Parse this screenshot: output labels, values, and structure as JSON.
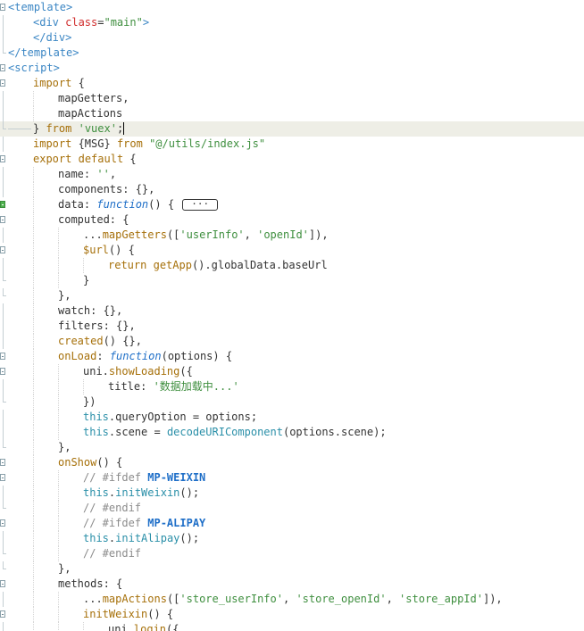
{
  "editor": {
    "lines": [
      {
        "fold": "open",
        "indent": 0,
        "tokens": [
          [
            "tag",
            "<template>"
          ]
        ]
      },
      {
        "fold": "line",
        "indent": 1,
        "tokens": [
          [
            "tag",
            "<div "
          ],
          [
            "attr",
            "class"
          ],
          [
            "pl",
            "="
          ],
          [
            "str",
            "\"main\""
          ],
          [
            "tag",
            ">"
          ]
        ]
      },
      {
        "fold": "line",
        "indent": 1,
        "tokens": [
          [
            "tag",
            "</div>"
          ]
        ]
      },
      {
        "fold": "end",
        "indent": 0,
        "tokens": [
          [
            "tag",
            "</template>"
          ]
        ]
      },
      {
        "fold": "open",
        "indent": 0,
        "tokens": [
          [
            "tag",
            "<script>"
          ]
        ]
      },
      {
        "fold": "open",
        "indent": 1,
        "tokens": [
          [
            "kw",
            "import"
          ],
          [
            "pl",
            " {"
          ]
        ]
      },
      {
        "fold": "line",
        "indent": 2,
        "tokens": [
          [
            "pl",
            "mapGetters,"
          ]
        ]
      },
      {
        "fold": "line",
        "indent": 2,
        "tokens": [
          [
            "pl",
            "mapActions"
          ]
        ]
      },
      {
        "fold": "end",
        "indent": 1,
        "current": true,
        "caret": true,
        "tokens": [
          [
            "pl",
            "} "
          ],
          [
            "kw",
            "from"
          ],
          [
            "pl",
            " "
          ],
          [
            "str",
            "'vuex'"
          ],
          [
            "pl",
            ";"
          ]
        ]
      },
      {
        "fold": "line",
        "indent": 1,
        "tokens": [
          [
            "kw",
            "import"
          ],
          [
            "pl",
            " {MSG} "
          ],
          [
            "kw",
            "from"
          ],
          [
            "pl",
            " "
          ],
          [
            "str",
            "\"@/utils/index.js\""
          ]
        ]
      },
      {
        "fold": "open",
        "indent": 1,
        "tokens": [
          [
            "kw",
            "export"
          ],
          [
            "pl",
            " "
          ],
          [
            "kw",
            "default"
          ],
          [
            "pl",
            " {"
          ]
        ]
      },
      {
        "fold": "line",
        "indent": 2,
        "tokens": [
          [
            "pl",
            "name: "
          ],
          [
            "str",
            "''"
          ],
          [
            "pl",
            ","
          ]
        ]
      },
      {
        "fold": "line",
        "indent": 2,
        "tokens": [
          [
            "pl",
            "components: {},"
          ]
        ]
      },
      {
        "fold": "collapsed",
        "indent": 2,
        "placeholder": "···",
        "tokens": [
          [
            "pl",
            "data: "
          ],
          [
            "kwi",
            "function"
          ],
          [
            "pl",
            "() { "
          ]
        ]
      },
      {
        "fold": "open",
        "indent": 2,
        "tokens": [
          [
            "pl",
            "computed: {"
          ]
        ]
      },
      {
        "fold": "line",
        "indent": 3,
        "tokens": [
          [
            "pl",
            "..."
          ],
          [
            "fn",
            "mapGetters"
          ],
          [
            "pl",
            "(["
          ],
          [
            "str",
            "'userInfo'"
          ],
          [
            "pl",
            ", "
          ],
          [
            "str",
            "'openId'"
          ],
          [
            "pl",
            "]),"
          ]
        ]
      },
      {
        "fold": "open",
        "indent": 3,
        "tokens": [
          [
            "fn",
            "$url"
          ],
          [
            "pl",
            "() {"
          ]
        ]
      },
      {
        "fold": "line",
        "indent": 4,
        "tokens": [
          [
            "kw",
            "return"
          ],
          [
            "pl",
            " "
          ],
          [
            "fn",
            "getApp"
          ],
          [
            "pl",
            "().globalData.baseUrl"
          ]
        ]
      },
      {
        "fold": "end",
        "indent": 3,
        "tokens": [
          [
            "pl",
            "}"
          ]
        ]
      },
      {
        "fold": "end",
        "indent": 2,
        "tokens": [
          [
            "pl",
            "},"
          ]
        ]
      },
      {
        "fold": "line",
        "indent": 2,
        "tokens": [
          [
            "pl",
            "watch: {},"
          ]
        ]
      },
      {
        "fold": "line",
        "indent": 2,
        "tokens": [
          [
            "pl",
            "filters: {},"
          ]
        ]
      },
      {
        "fold": "line",
        "indent": 2,
        "tokens": [
          [
            "fn",
            "created"
          ],
          [
            "pl",
            "() {},"
          ]
        ]
      },
      {
        "fold": "open",
        "indent": 2,
        "tokens": [
          [
            "fn",
            "onLoad"
          ],
          [
            "pl",
            ": "
          ],
          [
            "kwi",
            "function"
          ],
          [
            "pl",
            "(options) {"
          ]
        ]
      },
      {
        "fold": "open",
        "indent": 3,
        "tokens": [
          [
            "pl",
            "uni."
          ],
          [
            "fn",
            "showLoading"
          ],
          [
            "pl",
            "({"
          ]
        ]
      },
      {
        "fold": "line",
        "indent": 4,
        "tokens": [
          [
            "pl",
            "title: "
          ],
          [
            "str",
            "'数据加载中...'"
          ]
        ]
      },
      {
        "fold": "end",
        "indent": 3,
        "tokens": [
          [
            "pl",
            "})"
          ]
        ]
      },
      {
        "fold": "line",
        "indent": 3,
        "tokens": [
          [
            "call",
            "this"
          ],
          [
            "pl",
            ".queryOption = options;"
          ]
        ]
      },
      {
        "fold": "line",
        "indent": 3,
        "tokens": [
          [
            "call",
            "this"
          ],
          [
            "pl",
            ".scene = "
          ],
          [
            "call",
            "decodeURIComponent"
          ],
          [
            "pl",
            "(options.scene);"
          ]
        ]
      },
      {
        "fold": "end",
        "indent": 2,
        "tokens": [
          [
            "pl",
            "},"
          ]
        ]
      },
      {
        "fold": "open",
        "indent": 2,
        "tokens": [
          [
            "fn",
            "onShow"
          ],
          [
            "pl",
            "() {"
          ]
        ]
      },
      {
        "fold": "open",
        "indent": 3,
        "tokens": [
          [
            "cm",
            "// #ifdef "
          ],
          [
            "dir",
            "MP-WEIXIN"
          ]
        ]
      },
      {
        "fold": "line",
        "indent": 3,
        "tokens": [
          [
            "call",
            "this"
          ],
          [
            "pl",
            "."
          ],
          [
            "call",
            "initWeixin"
          ],
          [
            "pl",
            "();"
          ]
        ]
      },
      {
        "fold": "end",
        "indent": 3,
        "tokens": [
          [
            "cm",
            "// #endif"
          ]
        ]
      },
      {
        "fold": "open",
        "indent": 3,
        "tokens": [
          [
            "cm",
            "// #ifdef "
          ],
          [
            "dir",
            "MP-ALIPAY"
          ]
        ]
      },
      {
        "fold": "line",
        "indent": 3,
        "tokens": [
          [
            "call",
            "this"
          ],
          [
            "pl",
            "."
          ],
          [
            "call",
            "initAlipay"
          ],
          [
            "pl",
            "();"
          ]
        ]
      },
      {
        "fold": "end",
        "indent": 3,
        "tokens": [
          [
            "cm",
            "// #endif"
          ]
        ]
      },
      {
        "fold": "end",
        "indent": 2,
        "tokens": [
          [
            "pl",
            "},"
          ]
        ]
      },
      {
        "fold": "open",
        "indent": 2,
        "tokens": [
          [
            "pl",
            "methods: {"
          ]
        ]
      },
      {
        "fold": "line",
        "indent": 3,
        "tokens": [
          [
            "pl",
            "..."
          ],
          [
            "fn",
            "mapActions"
          ],
          [
            "pl",
            "(["
          ],
          [
            "str",
            "'store_userInfo'"
          ],
          [
            "pl",
            ", "
          ],
          [
            "str",
            "'store_openId'"
          ],
          [
            "pl",
            ", "
          ],
          [
            "str",
            "'store_appId'"
          ],
          [
            "pl",
            "]),"
          ]
        ]
      },
      {
        "fold": "open",
        "indent": 3,
        "tokens": [
          [
            "fn",
            "initWeixin"
          ],
          [
            "pl",
            "() {"
          ]
        ]
      },
      {
        "fold": "line",
        "indent": 4,
        "tokens": [
          [
            "pl",
            "uni."
          ],
          [
            "fn",
            "login"
          ],
          [
            "pl",
            "({"
          ]
        ]
      }
    ]
  },
  "colors": {
    "tag": "#3b86c4",
    "attribute": "#d02c2c",
    "string": "#3f8f3f",
    "keyword": "#a6700a",
    "function_keyword": "#1f6fc8",
    "comment": "#8c8c8c",
    "current_line": "#eeeee6",
    "fold_collapsed": "#4fb24f"
  }
}
